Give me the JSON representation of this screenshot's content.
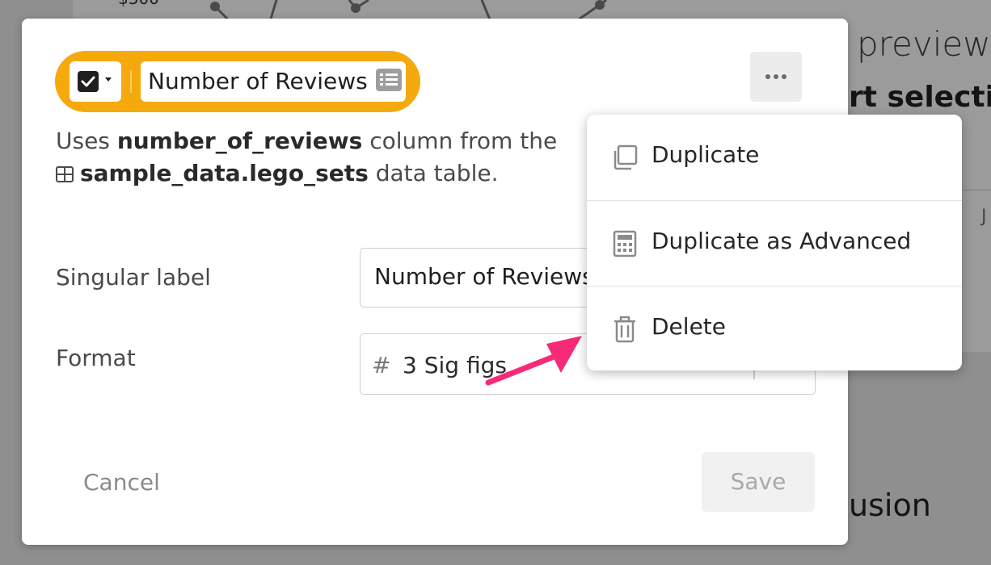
{
  "background": {
    "price_tick": "$300 —",
    "preview_text": "preview",
    "selection_text": "rt selection",
    "fusion_text": "usion",
    "j_text": "J"
  },
  "metric_pill": {
    "name": "Number of Reviews",
    "checked": true,
    "accent_color": "#f5a90c"
  },
  "description": {
    "prefix": "Uses",
    "column": "number_of_reviews",
    "middle": "column from the",
    "table": "sample_data.lego_sets",
    "suffix": "data table."
  },
  "form": {
    "singular_label": "Singular label",
    "singular_value": "Number of Reviews",
    "format_label": "Format",
    "format_icon": "#",
    "format_value": "3 Sig figs"
  },
  "buttons": {
    "cancel": "Cancel",
    "save": "Save"
  },
  "menu": {
    "items": [
      {
        "label": "Duplicate",
        "icon": "copy-icon"
      },
      {
        "label": "Duplicate as Advanced",
        "icon": "calculator-icon"
      },
      {
        "label": "Delete",
        "icon": "trash-icon"
      }
    ]
  },
  "annotation_color": "#f72a78"
}
